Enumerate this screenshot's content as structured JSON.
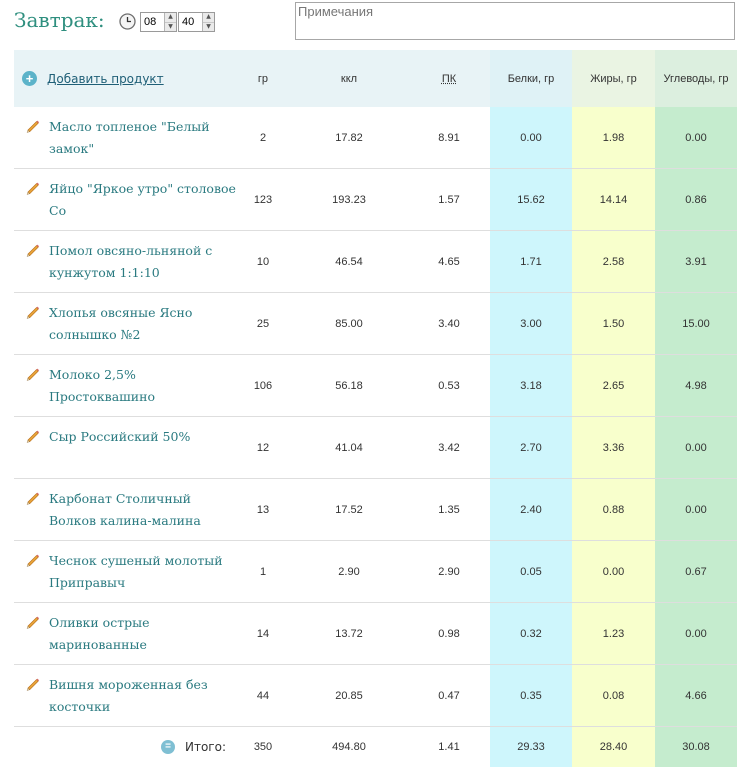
{
  "meal": {
    "title": "Завтрак:",
    "hours": "08",
    "minutes": "40",
    "notes_placeholder": "Примечания"
  },
  "table": {
    "add_label": "Добавить продукт",
    "columns": [
      "гр",
      "ккл",
      "ПК",
      "Белки, гр",
      "Жиры, гр",
      "Углеводы, гр"
    ],
    "rows": [
      {
        "name": "Масло топленое \"Белый замок\"",
        "gr": "2",
        "kkl": "17.82",
        "pk": "8.91",
        "b": "0.00",
        "f": "1.98",
        "u": "0.00"
      },
      {
        "name": "Яйцо \"Яркое утро\" столовое Со",
        "gr": "123",
        "kkl": "193.23",
        "pk": "1.57",
        "b": "15.62",
        "f": "14.14",
        "u": "0.86"
      },
      {
        "name": "Помол овсяно-льняной с кунжутом 1:1:10",
        "gr": "10",
        "kkl": "46.54",
        "pk": "4.65",
        "b": "1.71",
        "f": "2.58",
        "u": "3.91"
      },
      {
        "name": "Хлопья овсяные Ясно солнышко №2",
        "gr": "25",
        "kkl": "85.00",
        "pk": "3.40",
        "b": "3.00",
        "f": "1.50",
        "u": "15.00"
      },
      {
        "name": "Молоко 2,5% Простоквашино",
        "gr": "106",
        "kkl": "56.18",
        "pk": "0.53",
        "b": "3.18",
        "f": "2.65",
        "u": "4.98"
      },
      {
        "name": "Сыр Российский 50%",
        "gr": "12",
        "kkl": "41.04",
        "pk": "3.42",
        "b": "2.70",
        "f": "3.36",
        "u": "0.00"
      },
      {
        "name": "Карбонат Столичный Волков калина-малина",
        "gr": "13",
        "kkl": "17.52",
        "pk": "1.35",
        "b": "2.40",
        "f": "0.88",
        "u": "0.00"
      },
      {
        "name": "Чеснок сушеный молотый Приправыч",
        "gr": "1",
        "kkl": "2.90",
        "pk": "2.90",
        "b": "0.05",
        "f": "0.00",
        "u": "0.67"
      },
      {
        "name": "Оливки острые маринованные",
        "gr": "14",
        "kkl": "13.72",
        "pk": "0.98",
        "b": "0.32",
        "f": "1.23",
        "u": "0.00"
      },
      {
        "name": "Вишня мороженная без косточки",
        "gr": "44",
        "kkl": "20.85",
        "pk": "0.47",
        "b": "0.35",
        "f": "0.08",
        "u": "4.66"
      }
    ],
    "total": {
      "label": "Итого:",
      "gr": "350",
      "kkl": "494.80",
      "pk": "1.41",
      "b": "29.33",
      "f": "28.40",
      "u": "30.08"
    }
  },
  "colors": {
    "title": "#2f8f7f",
    "link": "#2a7a80",
    "protein_bg": "#cef6fc",
    "fat_bg": "#f8ffcc",
    "carb_bg": "#c5ecce"
  },
  "icons": {
    "clock": "clock-icon",
    "add": "plus-circle-icon",
    "edit": "pencil-icon",
    "total": "equals-circle-icon"
  }
}
